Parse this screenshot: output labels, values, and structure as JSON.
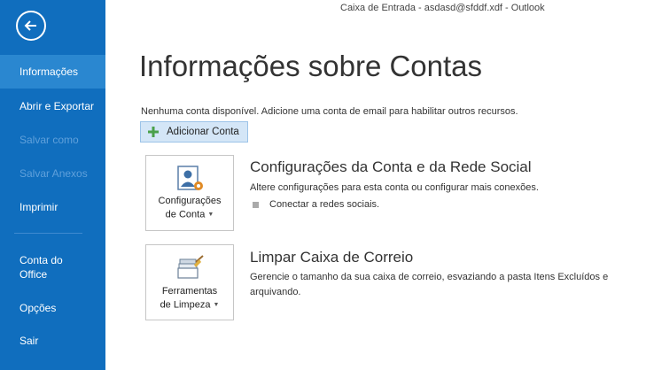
{
  "window": {
    "title": "Caixa de Entrada - asdasd@sfddf.xdf - Outlook"
  },
  "sidebar": {
    "items": [
      {
        "label": "Informações",
        "state": "active"
      },
      {
        "label": "Abrir e Exportar",
        "state": "normal"
      },
      {
        "label": "Salvar como",
        "state": "disabled"
      },
      {
        "label": "Salvar Anexos",
        "state": "disabled"
      },
      {
        "label": "Imprimir",
        "state": "normal"
      },
      {
        "label": "Conta do Office",
        "state": "normal"
      },
      {
        "label": "Opções",
        "state": "normal"
      },
      {
        "label": "Sair",
        "state": "normal"
      }
    ]
  },
  "main": {
    "title": "Informações sobre Contas",
    "info_text": "Nenhuma conta disponível. Adicione uma conta de email para habilitar outros recursos.",
    "add_account_label": "Adicionar Conta",
    "sections": [
      {
        "tile_label_line1": "Configurações",
        "tile_label_line2": "de Conta",
        "title": "Configurações da Conta e da Rede Social",
        "description": "Altere configurações para esta conta ou configurar mais conexões.",
        "bullet": "Conectar a redes sociais."
      },
      {
        "tile_label_line1": "Ferramentas",
        "tile_label_line2": "de Limpeza",
        "title": "Limpar Caixa de Correio",
        "description": "Gerencie o tamanho da sua caixa de correio, esvaziando a pasta Itens Excluídos e arquivando."
      }
    ]
  },
  "colors": {
    "sidebar": "#106ebe",
    "sidebar_active": "#2a87d0",
    "accent_button": "#d4e6f7"
  }
}
